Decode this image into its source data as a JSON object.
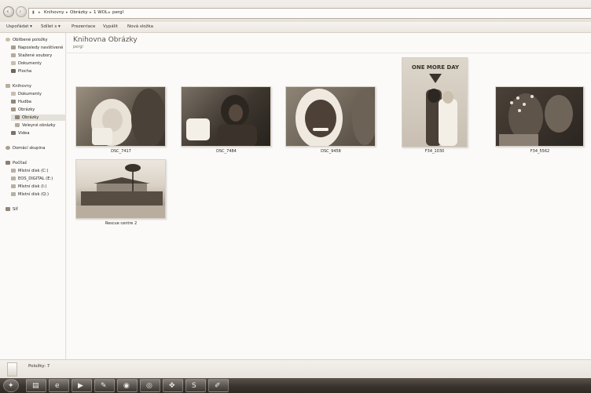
{
  "breadcrumb": [
    "Knihovny",
    "Obrázky",
    "1 WOL",
    "pergl"
  ],
  "toolbar": {
    "organize": "Uspořádat",
    "share": "Sdílet s",
    "slideshow": "Prezentace",
    "burn": "Vypálit",
    "new_folder": "Nová složka"
  },
  "sidebar": {
    "favorites": "Oblíbené položky",
    "recent": "Naposledy navštívené",
    "downloads": "Stažené soubory",
    "documents": "Dokumenty",
    "desktop": "Plocha",
    "libraries": "Knihovny",
    "lib_documents": "Dokumenty",
    "lib_music": "Hudba",
    "lib_pictures": "Obrázky",
    "lib_pictures_sub": "Obrázky",
    "lib_pictures_big": "Veleyné obrázky",
    "lib_video": "Videa",
    "homegroup": "Domácí skupina",
    "computer": "Počítač",
    "disk_c": "Místní disk (C:)",
    "disk_e": "EOS_DIGITAL (E:)",
    "disk_i": "Místní disk (I:)",
    "disk_q": "Místní disk (Q:)",
    "network": "Síť"
  },
  "main": {
    "title": "Knihovna Obrázky",
    "subtitle": "pergl",
    "files": [
      {
        "name": "DSC_7417"
      },
      {
        "name": "DSC_7484"
      },
      {
        "name": "DSC_9458"
      },
      {
        "name": "F34_1030",
        "poster_text": "ONE MORE DAY"
      },
      {
        "name": "F34_5562"
      },
      {
        "name": "Rescue centre 2"
      }
    ]
  },
  "status": {
    "items": "Položky: 7"
  },
  "colors": {
    "sepia_dark": "#2c2520",
    "sepia_mid": "#8a7f72",
    "sepia_light": "#f7f5f1"
  }
}
